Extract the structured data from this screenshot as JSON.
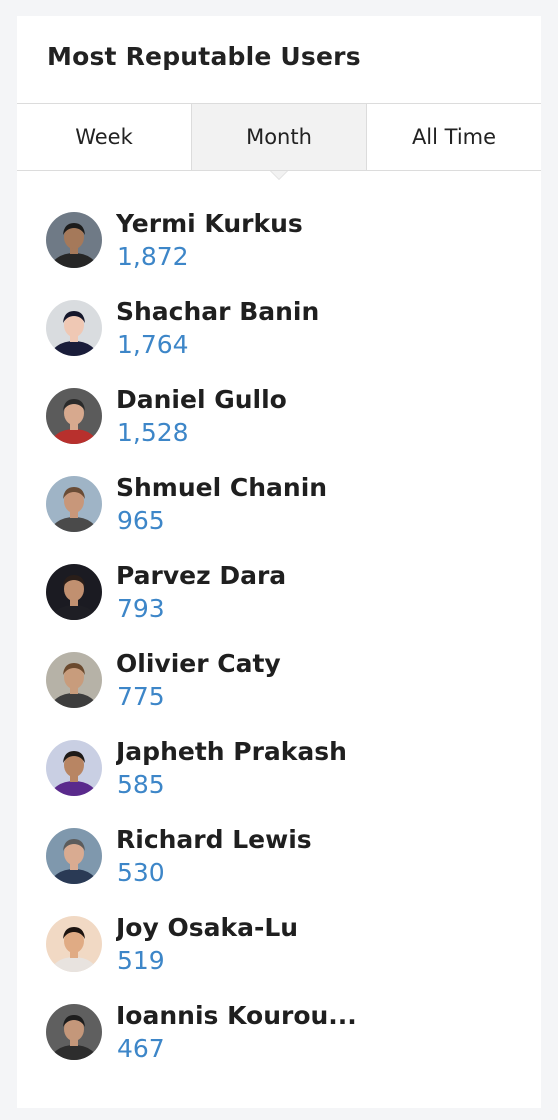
{
  "widget": {
    "title": "Most Reputable Users"
  },
  "tabs": [
    {
      "label": "Week",
      "active": false
    },
    {
      "label": "Month",
      "active": true
    },
    {
      "label": "All Time",
      "active": false
    }
  ],
  "users": [
    {
      "name": "Yermi Kurkus",
      "score": "1,872",
      "avatar_colors": {
        "bg": "#6f7a86",
        "skin": "#a5795a",
        "hair": "#1c1c1c",
        "shirt": "#262626"
      }
    },
    {
      "name": "Shachar Banin",
      "score": "1,764",
      "avatar_colors": {
        "bg": "#d9dcdf",
        "skin": "#efc8b4",
        "hair": "#15172b",
        "shirt": "#1a1d3a"
      }
    },
    {
      "name": "Daniel Gullo",
      "score": "1,528",
      "avatar_colors": {
        "bg": "#5b5b5b",
        "skin": "#d7a98e",
        "hair": "#2a2a2a",
        "shirt": "#b8302d"
      }
    },
    {
      "name": "Shmuel Chanin",
      "score": "965",
      "avatar_colors": {
        "bg": "#9fb4c6",
        "skin": "#c8977a",
        "hair": "#6a4c36",
        "shirt": "#4a4a4a"
      }
    },
    {
      "name": "Parvez Dara",
      "score": "793",
      "avatar_colors": {
        "bg": "#1b1b22",
        "skin": "#c19070",
        "hair": "#2a1e19",
        "shirt": "#1e1e24"
      }
    },
    {
      "name": "Olivier Caty",
      "score": "775",
      "avatar_colors": {
        "bg": "#b6b2a7",
        "skin": "#c89c7c",
        "hair": "#6b4a2e",
        "shirt": "#3d3d3d"
      }
    },
    {
      "name": "Japheth Prakash",
      "score": "585",
      "avatar_colors": {
        "bg": "#c9cfe3",
        "skin": "#b88563",
        "hair": "#1e1a18",
        "shirt": "#5a2a8c"
      }
    },
    {
      "name": "Richard Lewis",
      "score": "530",
      "avatar_colors": {
        "bg": "#7f98ad",
        "skin": "#d9ab91",
        "hair": "#5c5c5c",
        "shirt": "#2a3a55"
      }
    },
    {
      "name": "Joy Osaka-Lu",
      "score": "519",
      "avatar_colors": {
        "bg": "#f1d9c4",
        "skin": "#e0ab84",
        "hair": "#1d1410",
        "shirt": "#e8e3df"
      }
    },
    {
      "name": "Ioannis Kourou...",
      "score": "467",
      "avatar_colors": {
        "bg": "#5f5f5f",
        "skin": "#c4977a",
        "hair": "#1d1d1d",
        "shirt": "#2d2d2d"
      }
    }
  ]
}
